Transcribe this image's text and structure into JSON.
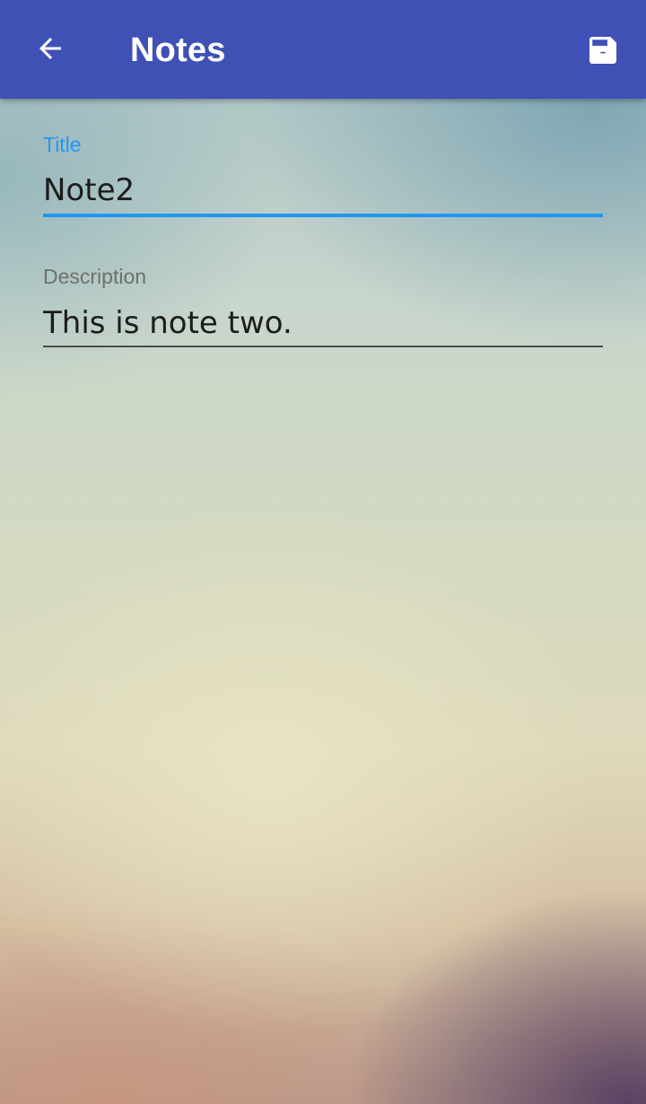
{
  "app_bar": {
    "title": "Notes",
    "background_color": "#3f51b5",
    "back_icon": "arrow-back-icon",
    "save_icon": "save-floppy-icon"
  },
  "form": {
    "title_field": {
      "label": "Title",
      "value": "Note2",
      "focused": true,
      "accent_color": "#2196f3"
    },
    "description_field": {
      "label": "Description",
      "value": "This is note two."
    }
  }
}
